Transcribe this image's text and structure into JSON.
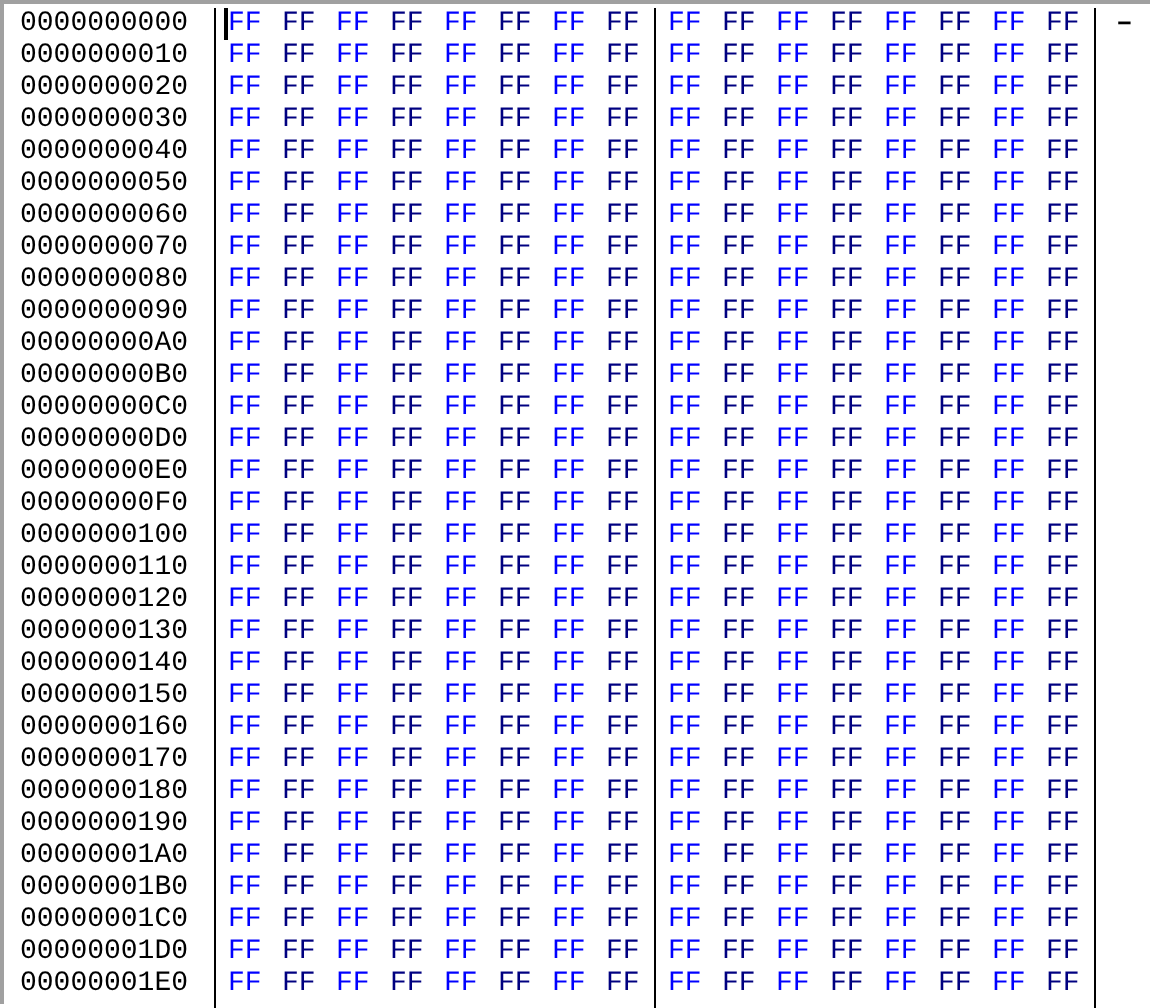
{
  "hex_columns": [
    {
      "color": "#0000ff"
    },
    {
      "color": "#000080"
    },
    {
      "color": "#0000ff"
    },
    {
      "color": "#000080"
    },
    {
      "color": "#0000ff"
    },
    {
      "color": "#000080"
    },
    {
      "color": "#0000ff"
    },
    {
      "color": "#000080"
    },
    {
      "color": "#0000ff"
    },
    {
      "color": "#000080"
    },
    {
      "color": "#0000ff"
    },
    {
      "color": "#000080"
    },
    {
      "color": "#0000ff"
    },
    {
      "color": "#000080"
    },
    {
      "color": "#0000ff"
    },
    {
      "color": "#000080"
    }
  ],
  "rows": [
    {
      "address": "0000000000",
      "caret": true,
      "bytes": [
        "FF",
        "FF",
        "FF",
        "FF",
        "FF",
        "FF",
        "FF",
        "FF",
        "FF",
        "FF",
        "FF",
        "FF",
        "FF",
        "FF",
        "FF",
        "FF"
      ],
      "ascii": "–"
    },
    {
      "address": "0000000010",
      "caret": false,
      "bytes": [
        "FF",
        "FF",
        "FF",
        "FF",
        "FF",
        "FF",
        "FF",
        "FF",
        "FF",
        "FF",
        "FF",
        "FF",
        "FF",
        "FF",
        "FF",
        "FF"
      ]
    },
    {
      "address": "0000000020",
      "caret": false,
      "bytes": [
        "FF",
        "FF",
        "FF",
        "FF",
        "FF",
        "FF",
        "FF",
        "FF",
        "FF",
        "FF",
        "FF",
        "FF",
        "FF",
        "FF",
        "FF",
        "FF"
      ]
    },
    {
      "address": "0000000030",
      "caret": false,
      "bytes": [
        "FF",
        "FF",
        "FF",
        "FF",
        "FF",
        "FF",
        "FF",
        "FF",
        "FF",
        "FF",
        "FF",
        "FF",
        "FF",
        "FF",
        "FF",
        "FF"
      ]
    },
    {
      "address": "0000000040",
      "caret": false,
      "bytes": [
        "FF",
        "FF",
        "FF",
        "FF",
        "FF",
        "FF",
        "FF",
        "FF",
        "FF",
        "FF",
        "FF",
        "FF",
        "FF",
        "FF",
        "FF",
        "FF"
      ]
    },
    {
      "address": "0000000050",
      "caret": false,
      "bytes": [
        "FF",
        "FF",
        "FF",
        "FF",
        "FF",
        "FF",
        "FF",
        "FF",
        "FF",
        "FF",
        "FF",
        "FF",
        "FF",
        "FF",
        "FF",
        "FF"
      ]
    },
    {
      "address": "0000000060",
      "caret": false,
      "bytes": [
        "FF",
        "FF",
        "FF",
        "FF",
        "FF",
        "FF",
        "FF",
        "FF",
        "FF",
        "FF",
        "FF",
        "FF",
        "FF",
        "FF",
        "FF",
        "FF"
      ]
    },
    {
      "address": "0000000070",
      "caret": false,
      "bytes": [
        "FF",
        "FF",
        "FF",
        "FF",
        "FF",
        "FF",
        "FF",
        "FF",
        "FF",
        "FF",
        "FF",
        "FF",
        "FF",
        "FF",
        "FF",
        "FF"
      ]
    },
    {
      "address": "0000000080",
      "caret": false,
      "bytes": [
        "FF",
        "FF",
        "FF",
        "FF",
        "FF",
        "FF",
        "FF",
        "FF",
        "FF",
        "FF",
        "FF",
        "FF",
        "FF",
        "FF",
        "FF",
        "FF"
      ]
    },
    {
      "address": "0000000090",
      "caret": false,
      "bytes": [
        "FF",
        "FF",
        "FF",
        "FF",
        "FF",
        "FF",
        "FF",
        "FF",
        "FF",
        "FF",
        "FF",
        "FF",
        "FF",
        "FF",
        "FF",
        "FF"
      ]
    },
    {
      "address": "00000000A0",
      "caret": false,
      "bytes": [
        "FF",
        "FF",
        "FF",
        "FF",
        "FF",
        "FF",
        "FF",
        "FF",
        "FF",
        "FF",
        "FF",
        "FF",
        "FF",
        "FF",
        "FF",
        "FF"
      ]
    },
    {
      "address": "00000000B0",
      "caret": false,
      "bytes": [
        "FF",
        "FF",
        "FF",
        "FF",
        "FF",
        "FF",
        "FF",
        "FF",
        "FF",
        "FF",
        "FF",
        "FF",
        "FF",
        "FF",
        "FF",
        "FF"
      ]
    },
    {
      "address": "00000000C0",
      "caret": false,
      "bytes": [
        "FF",
        "FF",
        "FF",
        "FF",
        "FF",
        "FF",
        "FF",
        "FF",
        "FF",
        "FF",
        "FF",
        "FF",
        "FF",
        "FF",
        "FF",
        "FF"
      ]
    },
    {
      "address": "00000000D0",
      "caret": false,
      "bytes": [
        "FF",
        "FF",
        "FF",
        "FF",
        "FF",
        "FF",
        "FF",
        "FF",
        "FF",
        "FF",
        "FF",
        "FF",
        "FF",
        "FF",
        "FF",
        "FF"
      ]
    },
    {
      "address": "00000000E0",
      "caret": false,
      "bytes": [
        "FF",
        "FF",
        "FF",
        "FF",
        "FF",
        "FF",
        "FF",
        "FF",
        "FF",
        "FF",
        "FF",
        "FF",
        "FF",
        "FF",
        "FF",
        "FF"
      ]
    },
    {
      "address": "00000000F0",
      "caret": false,
      "bytes": [
        "FF",
        "FF",
        "FF",
        "FF",
        "FF",
        "FF",
        "FF",
        "FF",
        "FF",
        "FF",
        "FF",
        "FF",
        "FF",
        "FF",
        "FF",
        "FF"
      ]
    },
    {
      "address": "0000000100",
      "caret": false,
      "bytes": [
        "FF",
        "FF",
        "FF",
        "FF",
        "FF",
        "FF",
        "FF",
        "FF",
        "FF",
        "FF",
        "FF",
        "FF",
        "FF",
        "FF",
        "FF",
        "FF"
      ]
    },
    {
      "address": "0000000110",
      "caret": false,
      "bytes": [
        "FF",
        "FF",
        "FF",
        "FF",
        "FF",
        "FF",
        "FF",
        "FF",
        "FF",
        "FF",
        "FF",
        "FF",
        "FF",
        "FF",
        "FF",
        "FF"
      ]
    },
    {
      "address": "0000000120",
      "caret": false,
      "bytes": [
        "FF",
        "FF",
        "FF",
        "FF",
        "FF",
        "FF",
        "FF",
        "FF",
        "FF",
        "FF",
        "FF",
        "FF",
        "FF",
        "FF",
        "FF",
        "FF"
      ]
    },
    {
      "address": "0000000130",
      "caret": false,
      "bytes": [
        "FF",
        "FF",
        "FF",
        "FF",
        "FF",
        "FF",
        "FF",
        "FF",
        "FF",
        "FF",
        "FF",
        "FF",
        "FF",
        "FF",
        "FF",
        "FF"
      ]
    },
    {
      "address": "0000000140",
      "caret": false,
      "bytes": [
        "FF",
        "FF",
        "FF",
        "FF",
        "FF",
        "FF",
        "FF",
        "FF",
        "FF",
        "FF",
        "FF",
        "FF",
        "FF",
        "FF",
        "FF",
        "FF"
      ]
    },
    {
      "address": "0000000150",
      "caret": false,
      "bytes": [
        "FF",
        "FF",
        "FF",
        "FF",
        "FF",
        "FF",
        "FF",
        "FF",
        "FF",
        "FF",
        "FF",
        "FF",
        "FF",
        "FF",
        "FF",
        "FF"
      ]
    },
    {
      "address": "0000000160",
      "caret": false,
      "bytes": [
        "FF",
        "FF",
        "FF",
        "FF",
        "FF",
        "FF",
        "FF",
        "FF",
        "FF",
        "FF",
        "FF",
        "FF",
        "FF",
        "FF",
        "FF",
        "FF"
      ]
    },
    {
      "address": "0000000170",
      "caret": false,
      "bytes": [
        "FF",
        "FF",
        "FF",
        "FF",
        "FF",
        "FF",
        "FF",
        "FF",
        "FF",
        "FF",
        "FF",
        "FF",
        "FF",
        "FF",
        "FF",
        "FF"
      ]
    },
    {
      "address": "0000000180",
      "caret": false,
      "bytes": [
        "FF",
        "FF",
        "FF",
        "FF",
        "FF",
        "FF",
        "FF",
        "FF",
        "FF",
        "FF",
        "FF",
        "FF",
        "FF",
        "FF",
        "FF",
        "FF"
      ]
    },
    {
      "address": "0000000190",
      "caret": false,
      "bytes": [
        "FF",
        "FF",
        "FF",
        "FF",
        "FF",
        "FF",
        "FF",
        "FF",
        "FF",
        "FF",
        "FF",
        "FF",
        "FF",
        "FF",
        "FF",
        "FF"
      ]
    },
    {
      "address": "00000001A0",
      "caret": false,
      "bytes": [
        "FF",
        "FF",
        "FF",
        "FF",
        "FF",
        "FF",
        "FF",
        "FF",
        "FF",
        "FF",
        "FF",
        "FF",
        "FF",
        "FF",
        "FF",
        "FF"
      ]
    },
    {
      "address": "00000001B0",
      "caret": false,
      "bytes": [
        "FF",
        "FF",
        "FF",
        "FF",
        "FF",
        "FF",
        "FF",
        "FF",
        "FF",
        "FF",
        "FF",
        "FF",
        "FF",
        "FF",
        "FF",
        "FF"
      ]
    },
    {
      "address": "00000001C0",
      "caret": false,
      "bytes": [
        "FF",
        "FF",
        "FF",
        "FF",
        "FF",
        "FF",
        "FF",
        "FF",
        "FF",
        "FF",
        "FF",
        "FF",
        "FF",
        "FF",
        "FF",
        "FF"
      ]
    },
    {
      "address": "00000001D0",
      "caret": false,
      "bytes": [
        "FF",
        "FF",
        "FF",
        "FF",
        "FF",
        "FF",
        "FF",
        "FF",
        "FF",
        "FF",
        "FF",
        "FF",
        "FF",
        "FF",
        "FF",
        "FF"
      ]
    },
    {
      "address": "00000001E0",
      "caret": false,
      "bytes": [
        "FF",
        "FF",
        "FF",
        "FF",
        "FF",
        "FF",
        "FF",
        "FF",
        "FF",
        "FF",
        "FF",
        "FF",
        "FF",
        "FF",
        "FF",
        "FF"
      ]
    }
  ]
}
